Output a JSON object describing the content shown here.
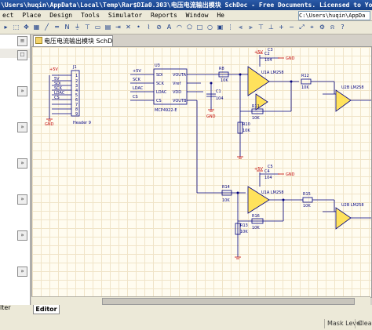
{
  "window": {
    "title": "\\Users\\huqin\\AppData\\Local\\Temp\\Rar$DIa0.303\\电压电流输出模块 SchDoc - Free Documents. Licensed to Your ..."
  },
  "menu": {
    "items": [
      "ect",
      "Place",
      "Design",
      "Tools",
      "Simulator",
      "Reports",
      "Window",
      "He"
    ]
  },
  "path_box": {
    "value": "C:\\Users\\huqin\\AppDa"
  },
  "document_tab": {
    "label": "电压电流输出模块 SchDoc"
  },
  "bottom": {
    "editor_tab": "Editor",
    "filter_label": "lter",
    "status": [
      "Mask Level",
      "Clear"
    ]
  },
  "schematic": {
    "j1": {
      "ref": "J1",
      "name": "Header 9",
      "vcc_label": "+5V",
      "gnd_label": "GND",
      "pins": [
        "1",
        "2",
        "3",
        "4",
        "5",
        "6",
        "7",
        "8",
        "9"
      ],
      "nets": [
        "5V",
        "SDI",
        "SCK",
        "LDAC",
        "CS",
        "",
        "",
        ""
      ]
    },
    "u3": {
      "ref": "U3",
      "part": "MCP4922-E",
      "left_pins": [
        "SDI",
        "SCK",
        "LDAC",
        "CS"
      ],
      "right_pins": [
        "VOUTA",
        "Vref",
        "VDD",
        "VOUTB"
      ],
      "left_nets": [
        "+5V",
        "SCK",
        "LDAC",
        "CS"
      ],
      "gnd_label": "GND"
    },
    "c1": {
      "ref": "C1",
      "value": "104"
    },
    "top_amp": {
      "r8": "R8",
      "r8_val": "10K",
      "c2": "C2",
      "c2_val": "104",
      "c3": "C3",
      "u1a": "U1A LM258",
      "r10": "R10",
      "r10_val": "10K",
      "r11": "R11",
      "r11_val": "10K",
      "r12": "R12",
      "r12_val": "10K",
      "supply": "+5V",
      "gnd": "GND"
    },
    "bottom_amp": {
      "r14": "R14",
      "r14_val": "10K",
      "c4": "C4",
      "c4_val": "104",
      "c5": "C5",
      "u1b": "U1A LM258",
      "r13": "R13",
      "r13_val": "10K",
      "r16": "R16",
      "r16_val": "10K",
      "r15": "R15",
      "r15_val": "10K",
      "supply": "+5V",
      "gnd": "GND"
    },
    "u2b_top": "U2B LM258",
    "u2b_bottom": "U2B LM258"
  }
}
